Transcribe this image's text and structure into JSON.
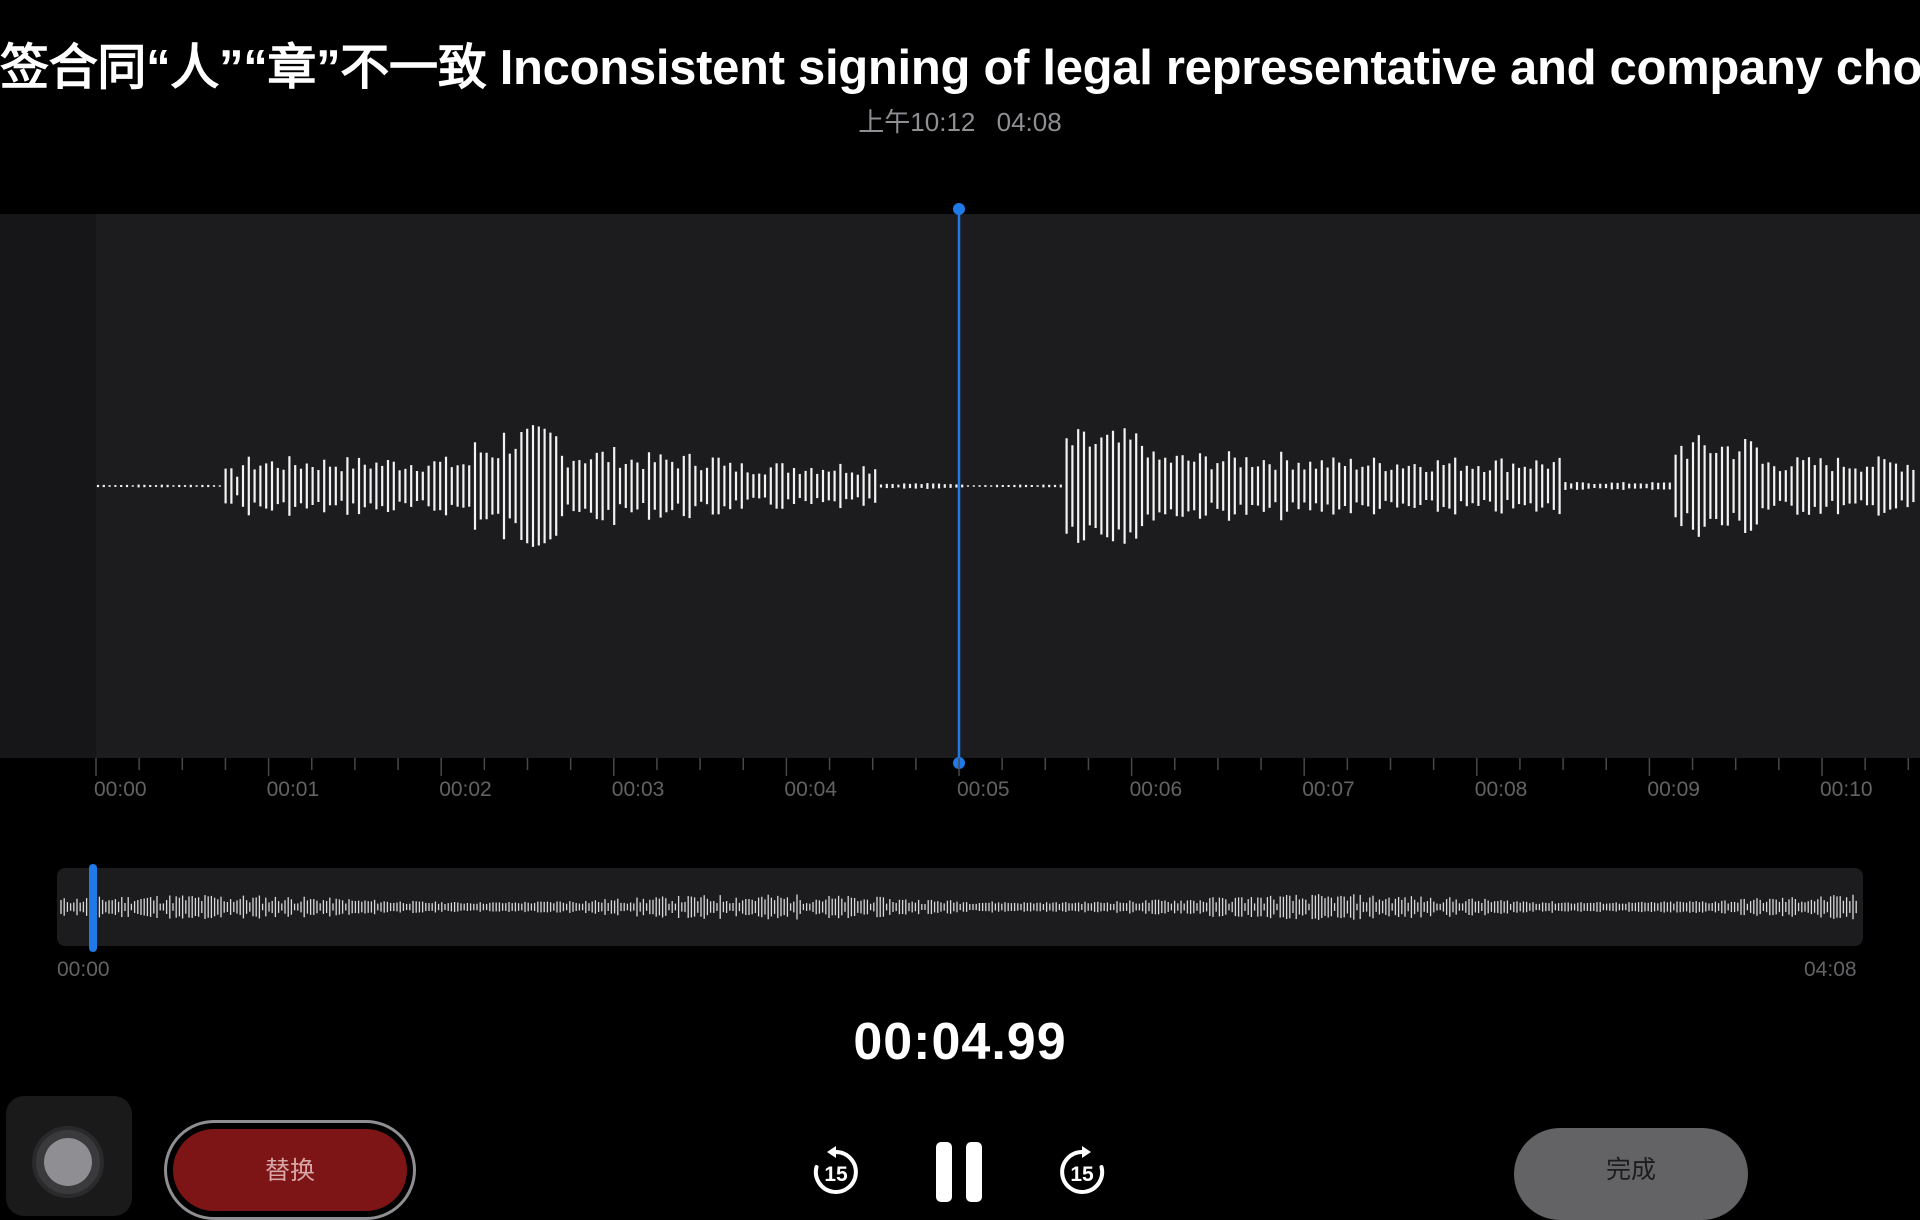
{
  "header": {
    "title": "签合同“人”“章”不一致 Inconsistent signing of legal representative and company chop",
    "recorded_time": "上午10:12",
    "duration": "04:08"
  },
  "timeline": {
    "tick_labels": [
      "00:00",
      "00:01",
      "00:02",
      "00:03",
      "00:04",
      "00:05",
      "00:06",
      "00:07",
      "00:08",
      "00:09",
      "00:10"
    ],
    "playhead_seconds": 5.0,
    "visible_seconds": 11
  },
  "overview": {
    "start_label": "00:00",
    "end_label": "04:08",
    "position_fraction": 0.02
  },
  "playback": {
    "current_time": "00:04.99"
  },
  "buttons": {
    "replace_label": "替换",
    "done_label": "完成",
    "skip_back_label": "15",
    "skip_forward_label": "15"
  },
  "colors": {
    "accent": "#1f7ae8",
    "replace_button": "#7d1416",
    "waveform": "#ffffff"
  },
  "icons": {
    "record": "record-icon",
    "skip_back": "skip-back-15-icon",
    "pause": "pause-icon",
    "skip_forward": "skip-forward-15-icon"
  }
}
